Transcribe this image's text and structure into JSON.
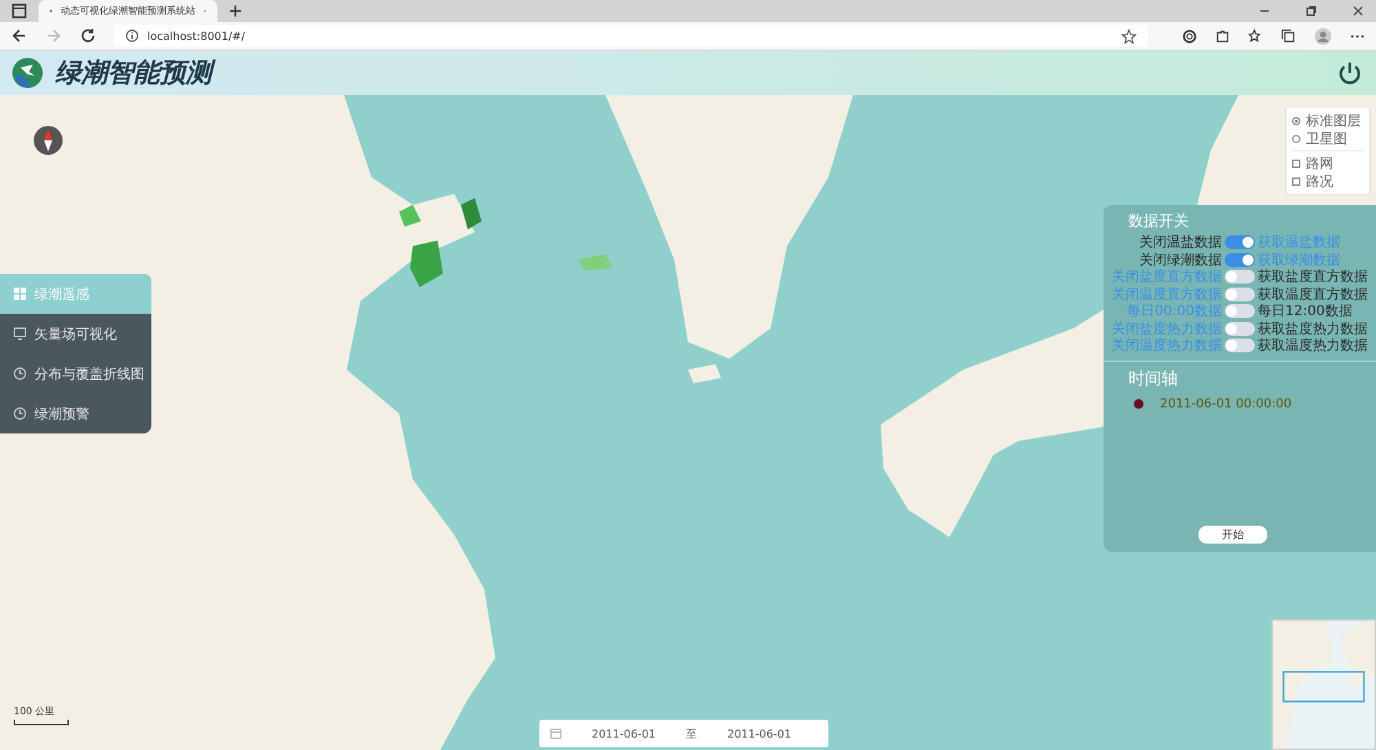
{
  "browser": {
    "tab_title": "动态可视化绿潮智能预测系统站",
    "url": "localhost:8001/#/"
  },
  "app": {
    "title": "绿潮智能预测"
  },
  "sidebar": {
    "items": [
      {
        "label": "绿潮遥感",
        "kind": "grid",
        "selected": true
      },
      {
        "label": "矢量场可视化",
        "kind": "monitor",
        "selected": false
      },
      {
        "label": "分布与覆盖折线图",
        "kind": "clock",
        "selected": false
      },
      {
        "label": "绿潮预警",
        "kind": "clock",
        "selected": false
      }
    ]
  },
  "map_type": {
    "options": [
      {
        "label": "标准图层",
        "selected": true
      },
      {
        "label": "卫星图",
        "selected": false
      }
    ],
    "overlays": [
      {
        "label": "路网",
        "checked": false
      },
      {
        "label": "路况",
        "checked": false
      }
    ]
  },
  "scale": "100 公里",
  "data_switches": {
    "title": "数据开关",
    "items": [
      {
        "off_label": "关闭温盐数据",
        "on_label": "获取温盐数据",
        "on": true
      },
      {
        "off_label": "关闭绿潮数据",
        "on_label": "获取绿潮数据",
        "on": true
      },
      {
        "off_label": "关闭盐度直方数据",
        "on_label": "获取盐度直方数据",
        "on": false
      },
      {
        "off_label": "关闭温度直方数据",
        "on_label": "获取温度直方数据",
        "on": false
      },
      {
        "off_label": "每日00:00数据",
        "on_label": "每日12:00数据",
        "on": false
      },
      {
        "off_label": "关闭盐度热力数据",
        "on_label": "获取盐度热力数据",
        "on": false
      },
      {
        "off_label": "关闭温度热力数据",
        "on_label": "获取温度热力数据",
        "on": false
      }
    ]
  },
  "timeline": {
    "title": "时间轴",
    "time": "2011-06-01 00:00:00",
    "start_button": "开始"
  },
  "date_range": {
    "start": "2011-06-01",
    "separator": "至",
    "end": "2011-06-01"
  }
}
